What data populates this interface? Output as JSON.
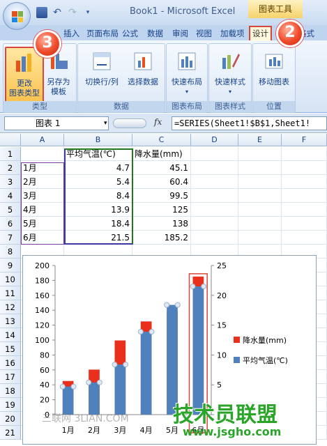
{
  "window": {
    "title": "Book1 - Microsoft Excel",
    "context_tab": "图表工具"
  },
  "tabs": [
    "插入",
    "页面布局",
    "公式",
    "数据",
    "审阅",
    "视图",
    "加载项",
    "设计",
    "格式"
  ],
  "ribbon": {
    "groups": [
      {
        "label": "类型",
        "buttons": [
          "更改\n图表类型",
          "另存为\n模板"
        ]
      },
      {
        "label": "数据",
        "buttons": [
          "切换行/列",
          "选择数据"
        ]
      },
      {
        "label": "图表布局",
        "buttons": [
          "快速布局"
        ]
      },
      {
        "label": "图表样式",
        "buttons": [
          "快速样式"
        ]
      },
      {
        "label": "位置",
        "buttons": [
          "移动图表"
        ]
      }
    ]
  },
  "formula_bar": {
    "name_box": "图表 1",
    "fx": "fx",
    "formula": "=SERIES(Sheet1!$B$1,Sheet1!"
  },
  "sheet": {
    "columns": [
      "A",
      "B",
      "C",
      "D",
      "E",
      "F"
    ],
    "rows": [
      "1",
      "2",
      "3",
      "4",
      "5",
      "6",
      "7",
      "8",
      "9",
      "10",
      "11",
      "12",
      "13",
      "14",
      "15",
      "16",
      "17",
      "18",
      "19",
      "20",
      "21"
    ],
    "header": [
      "",
      "平均气温(℃)",
      "降水量(mm)"
    ],
    "data": [
      [
        "1月",
        "4.7",
        "45.1"
      ],
      [
        "2月",
        "5.4",
        "60.4"
      ],
      [
        "3月",
        "8.4",
        "99.5"
      ],
      [
        "4月",
        "13.9",
        "125"
      ],
      [
        "5月",
        "18.4",
        "138"
      ],
      [
        "6月",
        "21.5",
        "185.2"
      ]
    ]
  },
  "badges": [
    "3",
    "2"
  ],
  "chart_data": {
    "type": "bar",
    "categories": [
      "1月",
      "2月",
      "3月",
      "4月",
      "5月",
      "6月"
    ],
    "series": [
      {
        "name": "平均气温(℃)",
        "values": [
          4.7,
          5.4,
          8.4,
          13.9,
          18.4,
          21.5
        ],
        "color": "#4f81bd",
        "axis": "right"
      },
      {
        "name": "降水量(mm)",
        "values": [
          45.1,
          60.4,
          99.5,
          125,
          138,
          185.2
        ],
        "color": "#e8301c",
        "axis": "left"
      }
    ],
    "left_axis": {
      "min": 0,
      "max": 200,
      "ticks": [
        "0",
        "20",
        "40",
        "60",
        "80",
        "100",
        "120",
        "140",
        "160",
        "180",
        "200"
      ]
    },
    "right_axis": {
      "min": 0,
      "max": 25,
      "ticks": [
        "0",
        "5",
        "10",
        "15",
        "20",
        "25"
      ]
    },
    "legend_position": "right"
  },
  "watermarks": [
    "三联网 3LIAN.COM",
    "技术员联盟",
    "www.jsgho.com"
  ],
  "colors": {
    "accent_red": "#d9463a",
    "ribbon_blue": "#15428b"
  }
}
